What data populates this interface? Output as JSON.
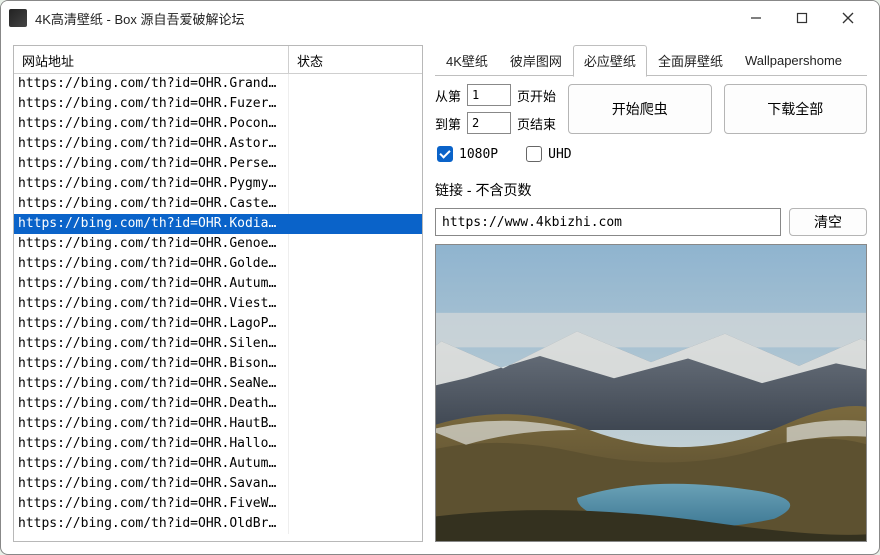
{
  "window": {
    "title": "4K高清壁纸 - Box    源自吾爱破解论坛"
  },
  "list": {
    "header_url": "网站地址",
    "header_status": "状态",
    "selected_index": 7,
    "rows": [
      "https://bing.com/th?id=OHR.Grand...",
      "https://bing.com/th?id=OHR.Fuzer...",
      "https://bing.com/th?id=OHR.Pocon...",
      "https://bing.com/th?id=OHR.Astor...",
      "https://bing.com/th?id=OHR.Perse...",
      "https://bing.com/th?id=OHR.Pygmy...",
      "https://bing.com/th?id=OHR.Caste...",
      "https://bing.com/th?id=OHR.Kodia...",
      "https://bing.com/th?id=OHR.Genoe...",
      "https://bing.com/th?id=OHR.Golde...",
      "https://bing.com/th?id=OHR.Autum...",
      "https://bing.com/th?id=OHR.Viest...",
      "https://bing.com/th?id=OHR.LagoP...",
      "https://bing.com/th?id=OHR.Silen...",
      "https://bing.com/th?id=OHR.Bison...",
      "https://bing.com/th?id=OHR.SeaNe...",
      "https://bing.com/th?id=OHR.Death...",
      "https://bing.com/th?id=OHR.HautB...",
      "https://bing.com/th?id=OHR.Hallo...",
      "https://bing.com/th?id=OHR.Autum...",
      "https://bing.com/th?id=OHR.Savan...",
      "https://bing.com/th?id=OHR.FiveW...",
      "https://bing.com/th?id=OHR.OldBr..."
    ]
  },
  "tabs": {
    "items": [
      "4K壁纸",
      "彼岸图网",
      "必应壁纸",
      "全面屏壁纸",
      "Wallpapershome"
    ],
    "active_index": 2
  },
  "page": {
    "from_label": "从第",
    "to_label": "到第",
    "from_value": "1",
    "to_value": "2",
    "start_suffix": "页开始",
    "end_suffix": "页结束",
    "crawl_label": "开始爬虫",
    "download_label": "下载全部"
  },
  "checks": {
    "hd_label": "1080P",
    "hd_checked": true,
    "uhd_label": "UHD",
    "uhd_checked": false
  },
  "link": {
    "label": "链接 - 不含页数",
    "value": "https://www.4kbizhi.com",
    "clear_label": "清空"
  }
}
